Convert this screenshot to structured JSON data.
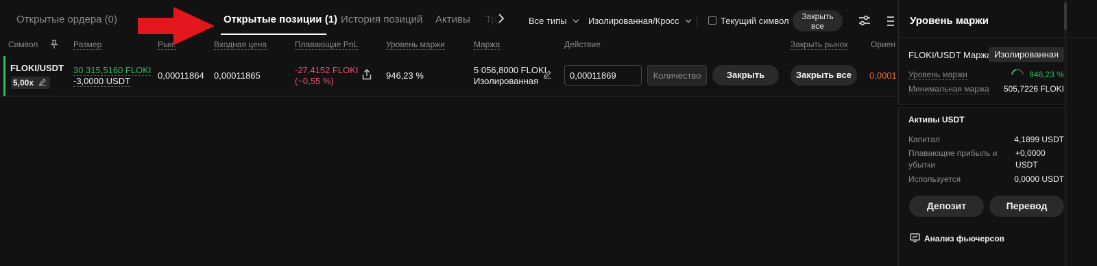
{
  "tabs": [
    {
      "label": "Открытые ордера (0)"
    },
    {
      "label": "Открытые позиции (1)"
    },
    {
      "label": "История позиций"
    },
    {
      "label": "Активы"
    },
    {
      "label": "Тр"
    }
  ],
  "filters": {
    "type_label": "Все типы",
    "margin_mode_label": "Изолированная/Кросс",
    "current_symbol_label": "Текущий символ",
    "close_all_label_1": "Закрыть",
    "close_all_label_2": "все"
  },
  "columns": {
    "symbol": "Символ",
    "size": "Размер",
    "market": "Рын.",
    "entry": "Входная цена",
    "pnl": "Плавающие PnL",
    "margin_level": "Уровень маржи",
    "margin": "Маржа",
    "action": "Действие",
    "close_market": "Закрыть рынок",
    "orient": "Ориен"
  },
  "position": {
    "symbol": "FLOKI/USDT",
    "leverage": "5,00x",
    "size_base": "30 315,5160 FLOKI",
    "size_quote": "-3,0000 USDT",
    "market_price": "0,00011864",
    "entry_price": "0,00011865",
    "pnl_value": "-27,4152 FLOKI",
    "pnl_percent": "(−0,55 %)",
    "margin_level": "946,23 %",
    "margin_value": "5 056,8000 FLOKI",
    "margin_mode": "Изолированная",
    "price_input_value": "0,00011869",
    "qty_placeholder": "Количество",
    "close_button": "Закрыть",
    "close_all_button": "Закрыть все",
    "orient_value": "0,0001"
  },
  "right_panel": {
    "title": "Уровень маржи",
    "pair_label": "FLOKI/USDT Маржа",
    "mode_badge": "Изолированная",
    "margin_level_label": "Уровень маржи",
    "margin_level_value": "946,23 %",
    "min_margin_label": "Минимальная маржа",
    "min_margin_value": "505,7226 FLOKI",
    "assets_title": "Активы USDT",
    "capital_label": "Капитал",
    "capital_value": "4,1899 USDT",
    "floating_label_1": "Плавающие прибыль и",
    "floating_label_2": "убытки",
    "floating_value_1": "+0,0000",
    "floating_value_2": "USDT",
    "used_label": "Используется",
    "used_value": "0,0000 USDT",
    "deposit_button": "Депозит",
    "transfer_button": "Перевод",
    "analysis_link": "Анализ фьючерсов"
  },
  "colors": {
    "positive": "#2ebd5f",
    "negative": "#f0506e",
    "accent_orange": "#ef6a2b",
    "arrow_red": "#e3151d"
  }
}
